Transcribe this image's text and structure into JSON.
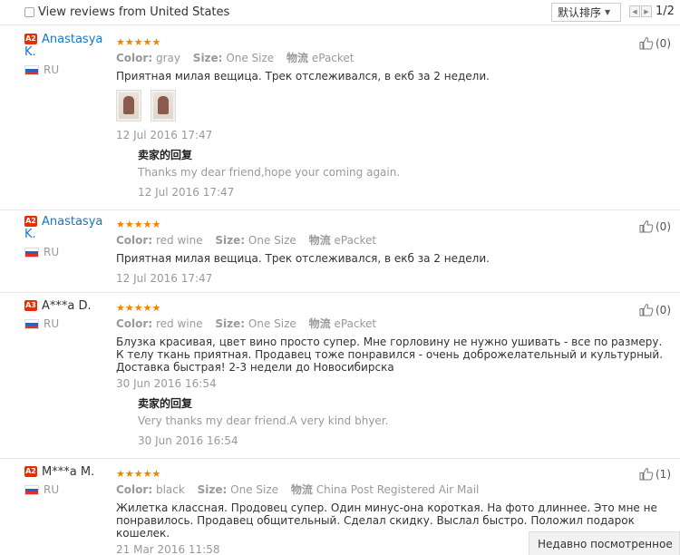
{
  "filter": {
    "label": "View reviews from United States",
    "checked": false
  },
  "sort": {
    "label": "默认排序"
  },
  "pager": {
    "page": "1/2"
  },
  "reply_label": "卖家的回复",
  "labels": {
    "color": "Color:",
    "size": "Size:",
    "logistics": "物流"
  },
  "reviews": [
    {
      "level": "A2",
      "name": "Anastasya K.",
      "country": "RU",
      "stars": "★★★★★",
      "color": "gray",
      "size": "One Size",
      "logistics": "ePacket",
      "text": "Приятная милая вещица. Трек отслеживался, в екб за 2 недели.",
      "date": "12 Jul 2016 17:47",
      "useful": "(0)",
      "photos": 2,
      "reply": {
        "text": "Thanks my dear friend,hope your coming again.",
        "date": "12 Jul 2016 17:47"
      }
    },
    {
      "level": "A2",
      "name": "Anastasya K.",
      "country": "RU",
      "stars": "★★★★★",
      "color": "red wine",
      "size": "One Size",
      "logistics": "ePacket",
      "text": "Приятная милая вещица. Трек отслеживался, в екб за 2 недели.",
      "date": "12 Jul 2016 17:47",
      "useful": "(0)"
    },
    {
      "level": "A3",
      "name": "A***a D.",
      "country": "RU",
      "stars": "★★★★★",
      "color": "red wine",
      "size": "One Size",
      "logistics": "ePacket",
      "text": "Блузка красивая, цвет вино просто супер. Мне горловину не нужно ушивать - все по размеру. К телу ткань приятная. Продавец тоже понравился - очень доброжелательный и культурный. Доставка быстрая! 2-3 недели до Новосибирска",
      "date": "30 Jun 2016 16:54",
      "useful": "(0)",
      "reply": {
        "text": "Very thanks my dear friend.A very kind bhyer.",
        "date": "30 Jun 2016 16:54"
      }
    },
    {
      "level": "A2",
      "name": "M***a M.",
      "country": "RU",
      "stars": "★★★★★",
      "color": "black",
      "size": "One Size",
      "logistics": "China Post Registered Air Mail",
      "text": "Жилетка классная. Продовец супер. Один минус-она короткая. На фото длиннее. Это мне не понравилось. Продавец общительный. Сделал скидку. Выслал быстро. Положил подарок кошелек.",
      "date": "21 Mar 2016 11:58",
      "useful": "(1)"
    }
  ],
  "recently_viewed": "Недавно посмотренное",
  "colors": {
    "link": "#1677c7",
    "star": "#f08300",
    "level_badge": "#e62e04"
  }
}
